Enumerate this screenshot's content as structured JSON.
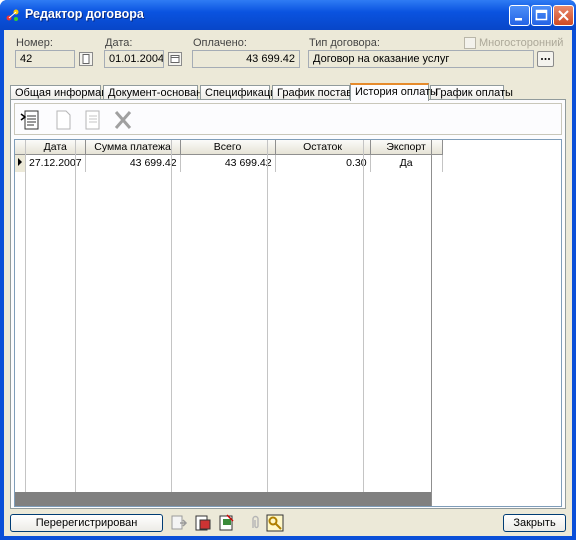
{
  "window": {
    "title": "Редактор договора"
  },
  "header": {
    "number_label": "Номер:",
    "number_value": "42",
    "date_label": "Дата:",
    "date_value": "01.01.2004",
    "paid_label": "Оплачено:",
    "paid_value": "43 699.42",
    "type_label": "Тип договора:",
    "type_value": "Договор на оказание услуг",
    "multilateral_label": "Многосторонний",
    "multilateral_checked": false
  },
  "tabs": [
    {
      "label": "Общая информация"
    },
    {
      "label": "Документ-основание"
    },
    {
      "label": "Спецификация"
    },
    {
      "label": "График поставки"
    },
    {
      "label": "История оплаты",
      "active": true
    },
    {
      "label": "График оплаты"
    }
  ],
  "grid": {
    "columns": [
      "Дата",
      "Сумма платежа",
      "Всего",
      "Остаток",
      "Экспорт"
    ],
    "rows": [
      [
        "27.12.2007",
        "43 699.42",
        "43 699.42",
        "0.30",
        "Да"
      ]
    ]
  },
  "footer": {
    "status_button": "Перерегистрирован",
    "close_button": "Закрыть"
  }
}
